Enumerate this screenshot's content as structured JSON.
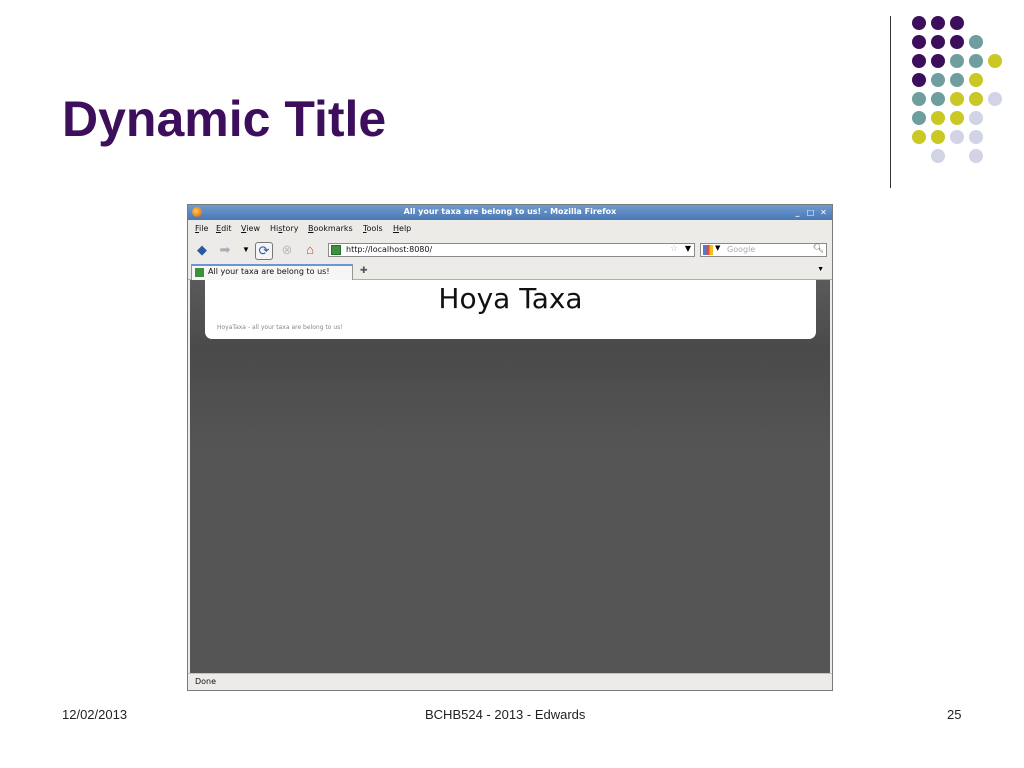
{
  "slide": {
    "title": "Dynamic Title",
    "footer_date": "12/02/2013",
    "footer_center": "BCHB524 - 2013 - Edwards",
    "footer_page": "25"
  },
  "colors": {
    "title": "#3d0e5c",
    "dot_purple": "#3d0e5c",
    "dot_teal": "#6e9e9e",
    "dot_yellow": "#c9c825",
    "dot_lavender": "#d3d3e6"
  },
  "browser": {
    "window_title": "All your taxa are belong to us! - Mozilla Firefox",
    "menu": [
      {
        "label": "File",
        "key": "F",
        "rest": "ile"
      },
      {
        "label": "Edit",
        "key": "E",
        "rest": "dit"
      },
      {
        "label": "View",
        "key": "V",
        "rest": "iew"
      },
      {
        "label": "History",
        "pre": "Hi",
        "key": "s",
        "rest": "tory"
      },
      {
        "label": "Bookmarks",
        "key": "B",
        "rest": "ookmarks"
      },
      {
        "label": "Tools",
        "key": "T",
        "rest": "ools"
      },
      {
        "label": "Help",
        "key": "H",
        "rest": "elp"
      }
    ],
    "url": "http://localhost:8080/",
    "search_placeholder": "Google",
    "tab_label": "All your taxa are belong to us!",
    "status": "Done",
    "icons": [
      "back-icon",
      "forward-icon",
      "history-dropdown-icon",
      "reload-icon",
      "stop-icon",
      "home-icon"
    ]
  },
  "page": {
    "heading": "Hoya Taxa",
    "tagline": "HoyaTaxa - all your taxa are belong to us!"
  }
}
